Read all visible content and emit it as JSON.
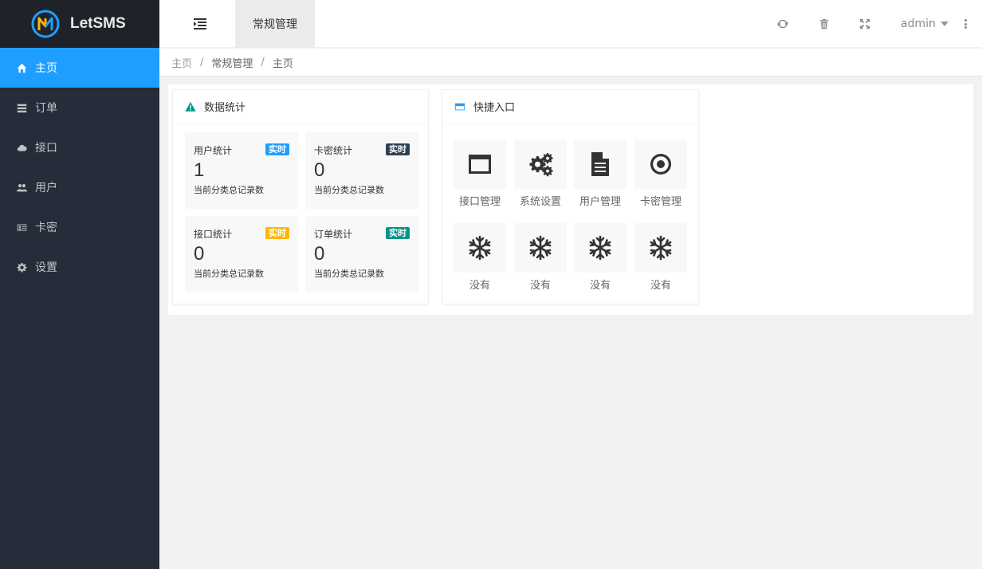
{
  "app": {
    "name": "LetSMS"
  },
  "sidebar": {
    "items": [
      {
        "label": "主页",
        "icon": "home-icon",
        "active": true
      },
      {
        "label": "订单",
        "icon": "list-icon",
        "active": false
      },
      {
        "label": "接口",
        "icon": "cloud-icon",
        "active": false
      },
      {
        "label": "用户",
        "icon": "users-icon",
        "active": false
      },
      {
        "label": "卡密",
        "icon": "id-card-icon",
        "active": false
      },
      {
        "label": "设置",
        "icon": "gear-icon",
        "active": false
      }
    ],
    "accent": "#1e9fff"
  },
  "header": {
    "tab": "常规管理",
    "user": "admin",
    "icons": [
      "menu-fold-icon",
      "refresh-icon",
      "trash-icon",
      "fullscreen-icon",
      "more-vertical-icon"
    ]
  },
  "breadcrumb": [
    "主页",
    "常规管理",
    "主页"
  ],
  "stats": {
    "title": "数据统计",
    "icon": "warning-icon",
    "items": [
      {
        "title": "用户统计",
        "badge": "实时",
        "badge_color": "#1e9fff",
        "value": "1",
        "desc": "当前分类总记录数"
      },
      {
        "title": "卡密统计",
        "badge": "实时",
        "badge_color": "#2f4056",
        "value": "0",
        "desc": "当前分类总记录数"
      },
      {
        "title": "接口统计",
        "badge": "实时",
        "badge_color": "#ffb800",
        "value": "0",
        "desc": "当前分类总记录数"
      },
      {
        "title": "订单统计",
        "badge": "实时",
        "badge_color": "#009688",
        "value": "0",
        "desc": "当前分类总记录数"
      }
    ]
  },
  "quick": {
    "title": "快捷入口",
    "icon": "credit-card-icon",
    "items": [
      {
        "label": "接口管理",
        "icon": "window-icon"
      },
      {
        "label": "系统设置",
        "icon": "gears-icon"
      },
      {
        "label": "用户管理",
        "icon": "file-text-icon"
      },
      {
        "label": "卡密管理",
        "icon": "dot-circle-icon"
      },
      {
        "label": "没有",
        "icon": "snowflake-icon"
      },
      {
        "label": "没有",
        "icon": "snowflake-icon"
      },
      {
        "label": "没有",
        "icon": "snowflake-icon"
      },
      {
        "label": "没有",
        "icon": "snowflake-icon"
      }
    ]
  }
}
